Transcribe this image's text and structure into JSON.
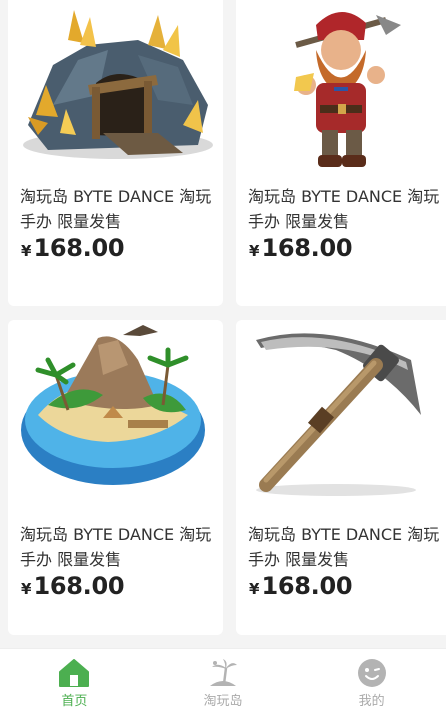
{
  "products": [
    {
      "name": "淘玩岛 BYTE DANCE 淘玩手办 限量发售",
      "currency": "¥",
      "price": "168.00",
      "image": "crystal-mine-icon"
    },
    {
      "name": "淘玩岛 BYTE DANCE 淘玩手办 限量发售",
      "currency": "¥",
      "price": "168.00",
      "image": "dwarf-miner-icon"
    },
    {
      "name": "淘玩岛 BYTE DANCE 淘玩手办 限量发售",
      "currency": "¥",
      "price": "168.00",
      "image": "tropical-island-icon"
    },
    {
      "name": "淘玩岛 BYTE DANCE 淘玩手办 限量发售",
      "currency": "¥",
      "price": "168.00",
      "image": "pickaxe-icon"
    }
  ],
  "tabbar": {
    "tabs": [
      {
        "label": "首页",
        "icon": "home-icon",
        "active": true
      },
      {
        "label": "淘玩岛",
        "icon": "island-icon",
        "active": false
      },
      {
        "label": "我的",
        "icon": "profile-icon",
        "active": false
      }
    ],
    "active_color": "#4caf50",
    "inactive_color": "#aaaaaa"
  }
}
